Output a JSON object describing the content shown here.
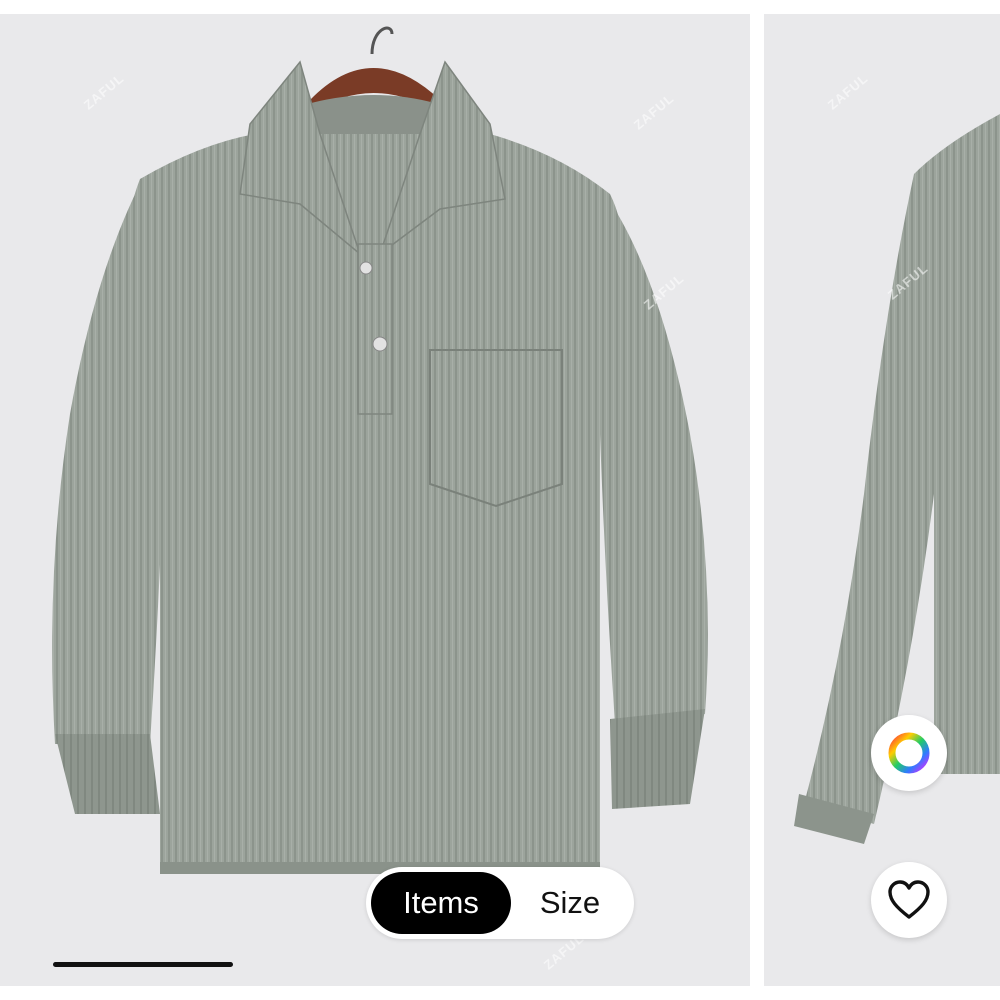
{
  "gallery": {
    "images": [
      {
        "description": "gray corduroy long-sleeve henley shirt with chest pocket on wooden hanger",
        "watermark": "ZAFUL"
      },
      {
        "description": "gray corduroy shirt partial view",
        "watermark": "ZAFUL"
      }
    ],
    "watermark_text": "ZAFUL"
  },
  "view_toggle": {
    "options": [
      "Items",
      "Size"
    ],
    "selected": "Items"
  },
  "actions": {
    "color_picker_icon": "color-wheel-icon",
    "favorite_icon": "heart-icon"
  },
  "colors": {
    "shirt": "#9aa29a",
    "background": "#e9e9eb",
    "toggle_active": "#000000"
  }
}
